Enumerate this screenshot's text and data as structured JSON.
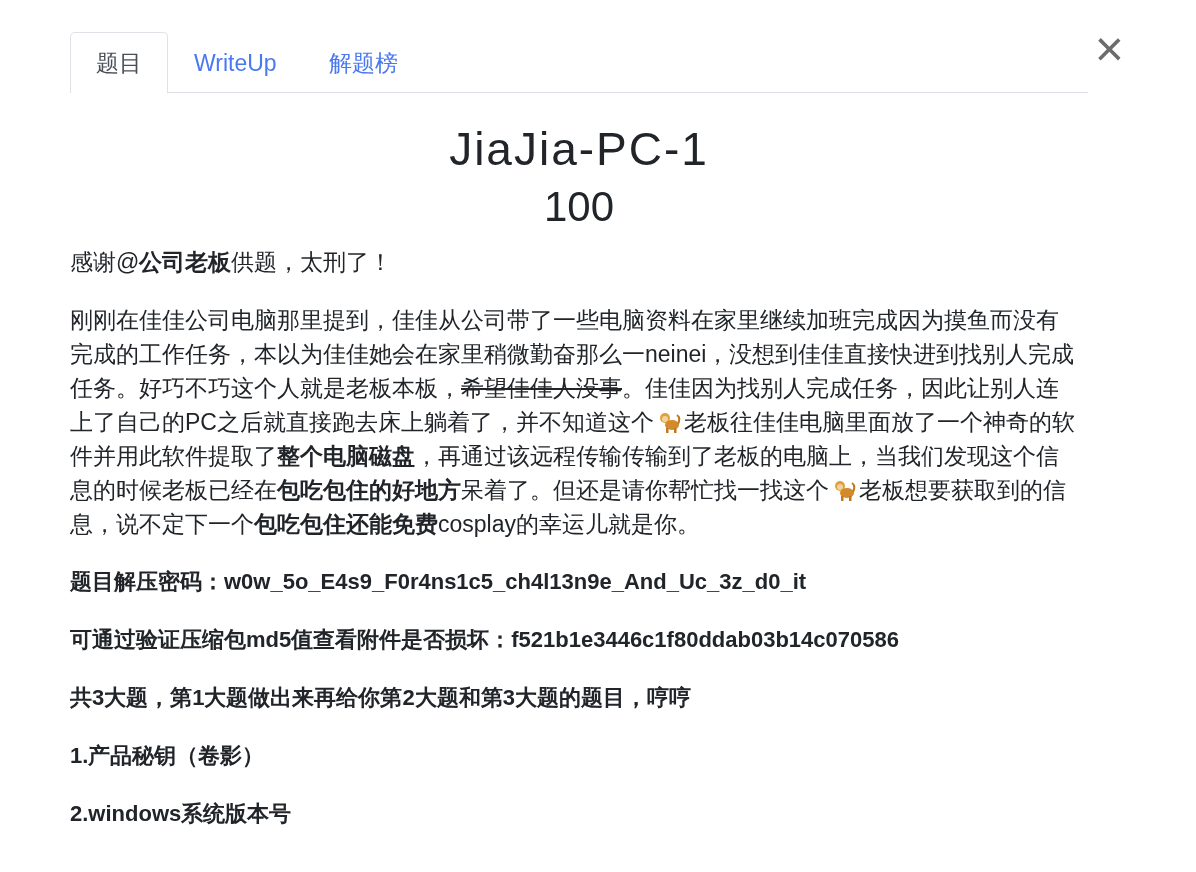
{
  "tabs": [
    {
      "label": "题目",
      "selected": true
    },
    {
      "label": "WriteUp",
      "selected": false
    },
    {
      "label": "解题榜",
      "selected": false
    }
  ],
  "close": {
    "label": "×"
  },
  "challenge": {
    "title": "JiaJia-PC-1",
    "points": "100"
  },
  "paragraphs": [
    {
      "bold": false,
      "lines": [
        [
          {
            "kind": "text",
            "text": "感谢@**公司老板**供题，太刑了！"
          }
        ]
      ]
    },
    {
      "bold": false,
      "lines": [
        [
          {
            "kind": "text",
            "text": "刚刚在佳佳公司电脑那里提到，佳佳从公司带了一些电脑资料在家里继续加班完成因为摸鱼而没有"
          }
        ],
        [
          {
            "kind": "text",
            "text": "完成的工作任务，本以为佳佳她会在家里稍微勤奋那么一neinei，没想到佳佳直接快进到找别人完成"
          }
        ],
        [
          {
            "kind": "text",
            "text": "任务。好巧不巧这个人就是老板本板，"
          },
          {
            "kind": "strike",
            "text": "希望佳佳人没事"
          },
          {
            "kind": "text",
            "text": "。佳佳因为找别人完成任务，因此让别人连"
          }
        ],
        [
          {
            "kind": "text",
            "text": "上了自己的PC之后就直接跑去床上躺着了，并不知道这个"
          },
          {
            "kind": "icon"
          },
          {
            "kind": "text",
            "text": "老板往佳佳电脑里面放了一个神奇的软"
          }
        ],
        [
          {
            "kind": "text",
            "text": "件并用此软件提取了**整个电脑磁盘**，再通过该远程传输传输到了老板的电脑上，当我们发现这个信"
          }
        ],
        [
          {
            "kind": "text",
            "text": "息的时候老板已经在**包吃包住的好地方**呆着了。但还是请你帮忙找一找这个"
          },
          {
            "kind": "icon"
          },
          {
            "kind": "text",
            "text": "老板想要获取到的信"
          }
        ],
        [
          {
            "kind": "text",
            "text": "息，说不定下一个**包吃包住还能免费**cosplay的幸运儿就是你。"
          }
        ]
      ]
    },
    {
      "bold": true,
      "lines": [
        [
          {
            "kind": "text",
            "text": "题目解压密码：w0w_5o_E4s9_F0r4ns1c5_ch4l13n9e_And_Uc_3z_d0_it"
          }
        ]
      ]
    },
    {
      "bold": true,
      "lines": [
        [
          {
            "kind": "text",
            "text": "可通过验证压缩包md5值查看附件是否损坏：f521b1e3446c1f80ddab03b14c070586"
          }
        ]
      ]
    },
    {
      "bold": true,
      "lines": [
        [
          {
            "kind": "text",
            "text": "共3大题，第1大题做出来再给你第2大题和第3大题的题目，哼哼"
          }
        ]
      ]
    },
    {
      "bold": true,
      "lines": [
        [
          {
            "kind": "text",
            "text": "1.产品秘钥（卷影）"
          }
        ]
      ]
    },
    {
      "bold": true,
      "lines": [
        [
          {
            "kind": "text",
            "text": "2.windows系统版本号"
          }
        ]
      ]
    }
  ]
}
